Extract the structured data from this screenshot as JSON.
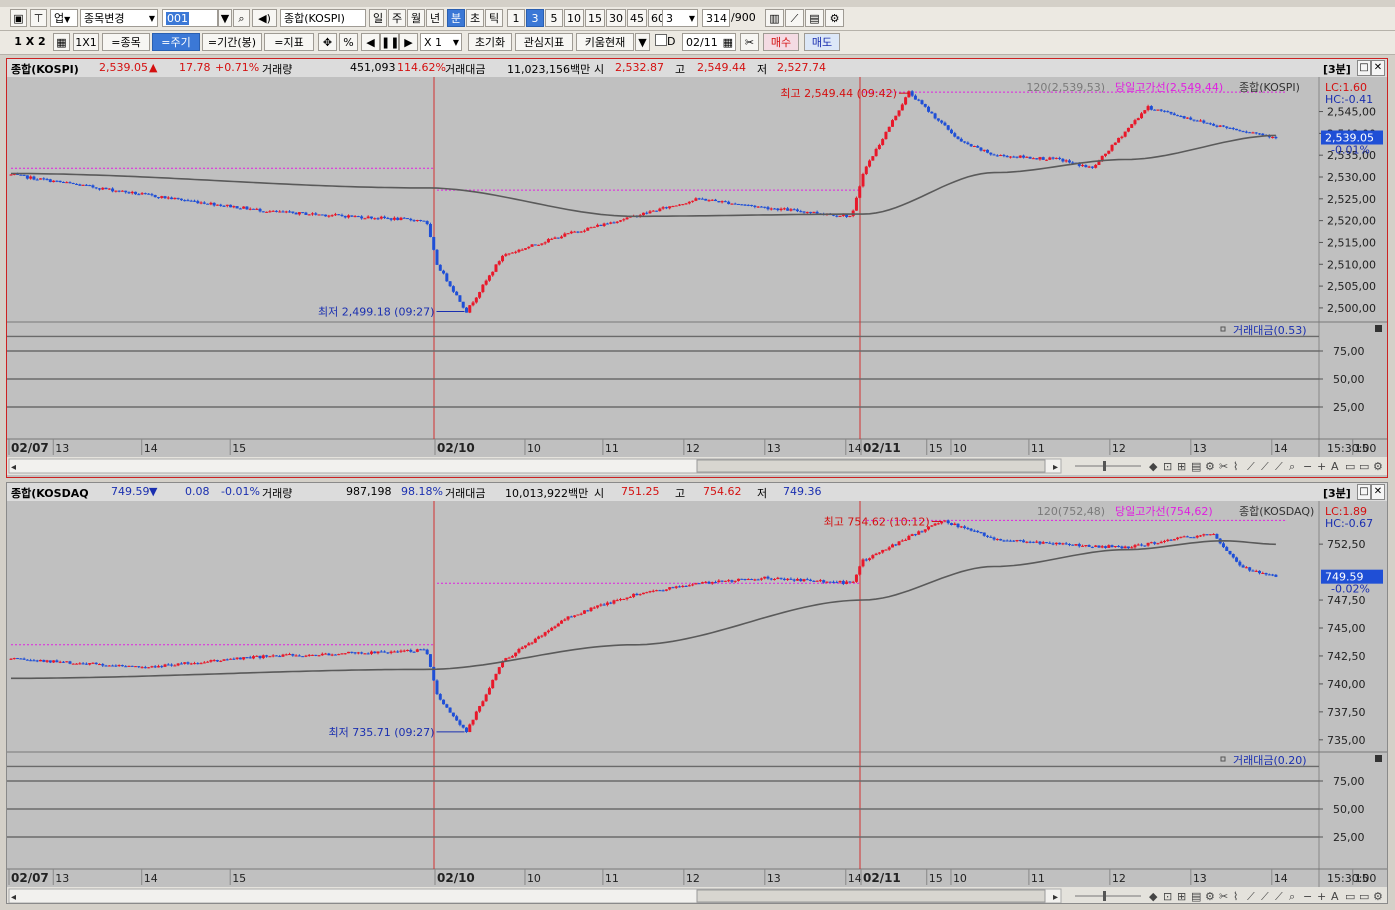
{
  "toolbar1": {
    "market_select": "업",
    "change_item": "종목변경",
    "code": "001",
    "index_name": "종합(KOSPI)",
    "periods": [
      "일",
      "주",
      "월",
      "년",
      "분",
      "초",
      "틱"
    ],
    "active_period": "분",
    "minute_options": [
      "1",
      "3",
      "5",
      "10",
      "15",
      "30",
      "45",
      "60"
    ],
    "active_minute": "3",
    "count_select": "3",
    "count": "314",
    "count_max": "/900"
  },
  "toolbar2": {
    "layout_1x2": "1 X 2",
    "layout_1x1": "1X1",
    "btn_item": "=종목",
    "btn_period": "=주기",
    "btn_range": "=기간(봉)",
    "btn_indicator": "=지표",
    "zoom": "X 1",
    "btn_reset": "초기화",
    "btn_interest": "관심지표",
    "btn_kiwoom": "키움현재",
    "check_d": "D",
    "date": "02/11",
    "btn_buy": "매수",
    "btn_sell": "매도"
  },
  "panels": [
    {
      "header": {
        "name": "종합(KOSPI)",
        "price": "2,539.05",
        "dir_icon": "triangle-up-icon",
        "change": "17.78",
        "change_pct": "+0.71%",
        "vol_label": "거래량",
        "volume": "451,093",
        "vol_pct": "114.62%",
        "amt_label": "거래대금",
        "amount": "11,023,156백만",
        "open_label": "시",
        "open": "2,532.87",
        "high_label": "고",
        "high": "2,549.44",
        "low_label": "저",
        "low": "2,527.74",
        "interval": "[3분]"
      },
      "chart_data": {
        "type": "candlestick",
        "title": "종합(KOSPI)",
        "sessions": [
          {
            "date": "02/07",
            "open": 2532,
            "high": 2532,
            "low": 2518,
            "close": 2521
          },
          {
            "date": "02/10",
            "open": 2510,
            "high": 2527,
            "low": 2499.18,
            "close": 2521
          },
          {
            "date": "02/11",
            "open": 2532.87,
            "high": 2549.44,
            "low": 2527.74,
            "close": 2539.05
          }
        ],
        "series": [
          {
            "name": "가격",
            "x": [
              "02/07 09:00",
              "02/07 11:00",
              "02/07 13:00",
              "02/07 15:20",
              "02/10 09:00",
              "02/10 09:27",
              "02/10 10:00",
              "02/10 11:00",
              "02/10 12:00",
              "02/10 13:00",
              "02/10 14:00",
              "02/10 15:20",
              "02/11 09:00",
              "02/11 09:42",
              "02/11 10:30",
              "02/11 11:00",
              "02/11 12:00",
              "02/11 12:30",
              "02/11 13:20",
              "02/11 14:20",
              "02/11 15:20"
            ],
            "values": [
              2530.5,
              2526,
              2522,
              2520,
              2510,
              2499.18,
              2512,
              2517,
              2521,
              2525,
              2523,
              2521,
              2531,
              2549.44,
              2538,
              2535,
              2534,
              2532,
              2546,
              2542,
              2539.05
            ]
          },
          {
            "name": "120",
            "x": [
              "02/07 09:00",
              "02/07 15:20",
              "02/10 12:00",
              "02/11 09:00",
              "02/11 11:00",
              "02/11 13:00",
              "02/11 15:20"
            ],
            "values": [
              2530.8,
              2527.5,
              2521,
              2521.5,
              2531,
              2534,
              2539.53
            ]
          }
        ],
        "indicator_labels": {
          "ma": "120(2,539,53)",
          "high_line": "당일고가선(2,549,44)",
          "legend": "종합(KOSPI)"
        },
        "annotations": {
          "high": "최고 2,549.44 (09:42)",
          "low": "최저 2,499.18 (09:27)",
          "lc": "LC:1.60",
          "hc": "HC:-0.41",
          "pct": "-0.01%",
          "last": "2,539.05"
        },
        "y_ticks": [
          "2,545,00",
          "2,540,00",
          "2,535,00",
          "2,530,00",
          "2,525,00",
          "2,520,00",
          "2,515,00",
          "2,510,00",
          "2,505,00",
          "2,500,00"
        ],
        "ylim": [
          2497,
          2552
        ],
        "x_ticks": [
          "02/07",
          "13",
          "14",
          "15",
          "02/10",
          "10",
          "11",
          "12",
          "13",
          "14",
          "15",
          "02/11",
          "10",
          "11",
          "12",
          "13",
          "14",
          "15"
        ],
        "x_end": "15:30:00",
        "sub_indicator": {
          "label": "거래대금(0.53)",
          "y_ticks": [
            "75,00",
            "50,00",
            "25,00"
          ]
        }
      }
    },
    {
      "header": {
        "name": "종합(KOSDAQ",
        "price": "749.59",
        "dir_icon": "triangle-down-icon",
        "change": "0.08",
        "change_pct": "-0.01%",
        "vol_label": "거래량",
        "volume": "987,198",
        "vol_pct": "98.18%",
        "amt_label": "거래대금",
        "amount": "10,013,922백만",
        "open_label": "시",
        "open": "751.25",
        "high_label": "고",
        "high": "754.62",
        "low_label": "저",
        "low": "749.36",
        "interval": "[3분]"
      },
      "chart_data": {
        "type": "candlestick",
        "title": "종합(KOSDAQ)",
        "sessions": [
          {
            "date": "02/07",
            "open": 742,
            "high": 743.5,
            "low": 741,
            "close": 743
          },
          {
            "date": "02/10",
            "open": 741,
            "high": 749,
            "low": 735.71,
            "close": 748
          },
          {
            "date": "02/11",
            "open": 751.25,
            "high": 754.62,
            "low": 749.36,
            "close": 749.59
          }
        ],
        "series": [
          {
            "name": "가격",
            "x": [
              "02/07 09:00",
              "02/07 11:00",
              "02/07 13:00",
              "02/07 15:20",
              "02/10 09:00",
              "02/10 09:27",
              "02/10 10:00",
              "02/10 11:00",
              "02/10 12:00",
              "02/10 13:00",
              "02/10 14:00",
              "02/10 15:20",
              "02/11 09:00",
              "02/11 10:12",
              "02/11 11:00",
              "02/11 12:00",
              "02/11 13:00",
              "02/11 14:20",
              "02/11 14:45",
              "02/11 15:20"
            ],
            "values": [
              742.2,
              741.5,
              742.5,
              743,
              739,
              735.71,
              742,
              746,
              748,
              749,
              749.5,
              749,
              751,
              754.62,
              753,
              752.5,
              752.2,
              753.5,
              750.5,
              749.59
            ]
          },
          {
            "name": "120",
            "x": [
              "02/07 09:00",
              "02/07 15:20",
              "02/10 12:00",
              "02/11 09:00",
              "02/11 11:00",
              "02/11 13:00",
              "02/11 14:30",
              "02/11 15:20"
            ],
            "values": [
              740.5,
              741.3,
              743.5,
              747.5,
              750.5,
              752,
              752.8,
              752.48
            ]
          }
        ],
        "indicator_labels": {
          "ma": "120(752,48)",
          "high_line": "당일고가선(754,62)",
          "legend": "종합(KOSDAQ)"
        },
        "annotations": {
          "high": "최고 754.62 (10:12)",
          "low": "최저 735.71 (09:27)",
          "lc": "LC:1.89",
          "hc": "HC:-0.67",
          "pct": "-0.02%",
          "last": "749.59"
        },
        "y_ticks": [
          "752,50",
          "747,50",
          "745,00",
          "742,50",
          "740,00",
          "737,50",
          "735,00"
        ],
        "ylim": [
          734,
          756
        ],
        "x_ticks": [
          "02/07",
          "13",
          "14",
          "15",
          "02/10",
          "10",
          "11",
          "12",
          "13",
          "14",
          "15",
          "02/11",
          "10",
          "11",
          "12",
          "13",
          "14",
          "15"
        ],
        "x_end": "15:30:00",
        "sub_indicator": {
          "label": "거래대금(0.20)",
          "y_ticks": [
            "75,00",
            "50,00",
            "25,00"
          ]
        }
      }
    }
  ]
}
